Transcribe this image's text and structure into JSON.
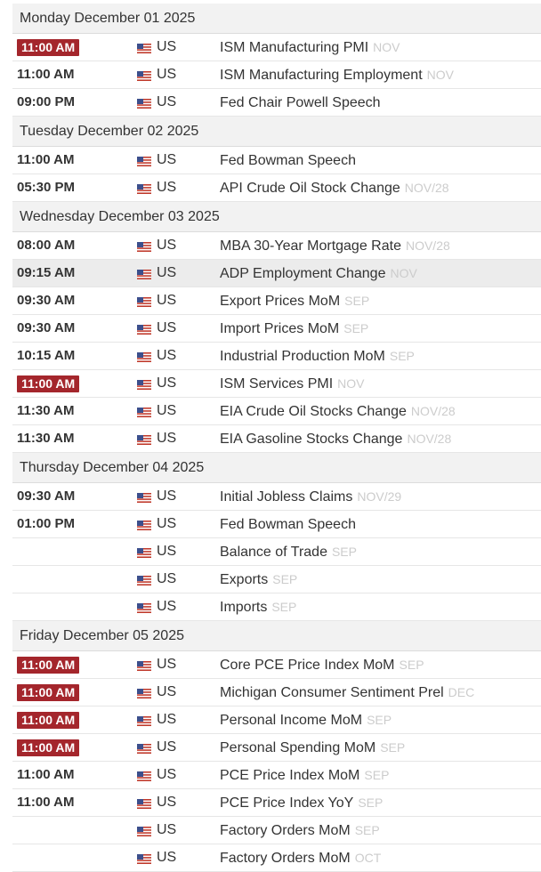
{
  "calendar": {
    "days": [
      {
        "header": "Monday December 01 2025",
        "events": [
          {
            "time": "11:00 AM",
            "badge": true,
            "country": "US",
            "name": "ISM Manufacturing PMI",
            "ref": "NOV"
          },
          {
            "time": "11:00 AM",
            "badge": false,
            "country": "US",
            "name": "ISM Manufacturing Employment",
            "ref": "NOV"
          },
          {
            "time": "09:00 PM",
            "badge": false,
            "country": "US",
            "name": "Fed Chair Powell Speech",
            "ref": ""
          }
        ]
      },
      {
        "header": "Tuesday December 02 2025",
        "events": [
          {
            "time": "11:00 AM",
            "badge": false,
            "country": "US",
            "name": "Fed Bowman Speech",
            "ref": ""
          },
          {
            "time": "05:30 PM",
            "badge": false,
            "country": "US",
            "name": "API Crude Oil Stock Change",
            "ref": "NOV/28"
          }
        ]
      },
      {
        "header": "Wednesday December 03 2025",
        "events": [
          {
            "time": "08:00 AM",
            "badge": false,
            "country": "US",
            "name": "MBA 30-Year Mortgage Rate",
            "ref": "NOV/28"
          },
          {
            "time": "09:15 AM",
            "badge": false,
            "country": "US",
            "name": "ADP Employment Change",
            "ref": "NOV",
            "highlight": true
          },
          {
            "time": "09:30 AM",
            "badge": false,
            "country": "US",
            "name": "Export Prices MoM",
            "ref": "SEP"
          },
          {
            "time": "09:30 AM",
            "badge": false,
            "country": "US",
            "name": "Import Prices MoM",
            "ref": "SEP"
          },
          {
            "time": "10:15 AM",
            "badge": false,
            "country": "US",
            "name": "Industrial Production MoM",
            "ref": "SEP"
          },
          {
            "time": "11:00 AM",
            "badge": true,
            "country": "US",
            "name": "ISM Services PMI",
            "ref": "NOV"
          },
          {
            "time": "11:30 AM",
            "badge": false,
            "country": "US",
            "name": "EIA Crude Oil Stocks Change",
            "ref": "NOV/28"
          },
          {
            "time": "11:30 AM",
            "badge": false,
            "country": "US",
            "name": "EIA Gasoline Stocks Change",
            "ref": "NOV/28"
          }
        ]
      },
      {
        "header": "Thursday December 04 2025",
        "events": [
          {
            "time": "09:30 AM",
            "badge": false,
            "country": "US",
            "name": "Initial Jobless Claims",
            "ref": "NOV/29"
          },
          {
            "time": "01:00 PM",
            "badge": false,
            "country": "US",
            "name": "Fed Bowman Speech",
            "ref": ""
          },
          {
            "time": "",
            "badge": false,
            "country": "US",
            "name": "Balance of Trade",
            "ref": "SEP"
          },
          {
            "time": "",
            "badge": false,
            "country": "US",
            "name": "Exports",
            "ref": "SEP"
          },
          {
            "time": "",
            "badge": false,
            "country": "US",
            "name": "Imports",
            "ref": "SEP"
          }
        ]
      },
      {
        "header": "Friday December 05 2025",
        "events": [
          {
            "time": "11:00 AM",
            "badge": true,
            "country": "US",
            "name": "Core PCE Price Index MoM",
            "ref": "SEP"
          },
          {
            "time": "11:00 AM",
            "badge": true,
            "country": "US",
            "name": "Michigan Consumer Sentiment Prel",
            "ref": "DEC"
          },
          {
            "time": "11:00 AM",
            "badge": true,
            "country": "US",
            "name": "Personal Income MoM",
            "ref": "SEP"
          },
          {
            "time": "11:00 AM",
            "badge": true,
            "country": "US",
            "name": "Personal Spending MoM",
            "ref": "SEP"
          },
          {
            "time": "11:00 AM",
            "badge": false,
            "country": "US",
            "name": "PCE Price Index MoM",
            "ref": "SEP"
          },
          {
            "time": "11:00 AM",
            "badge": false,
            "country": "US",
            "name": "PCE Price Index YoY",
            "ref": "SEP"
          },
          {
            "time": "",
            "badge": false,
            "country": "US",
            "name": "Factory Orders MoM",
            "ref": "SEP"
          },
          {
            "time": "",
            "badge": false,
            "country": "US",
            "name": "Factory Orders MoM",
            "ref": "OCT"
          }
        ]
      }
    ]
  },
  "colors": {
    "badge": "#a4262c",
    "header_bg": "#f2f2f2",
    "ref_text": "#cccccc",
    "highlight_row": "#ececec"
  },
  "icons": {
    "flag": "us-flag-icon"
  }
}
